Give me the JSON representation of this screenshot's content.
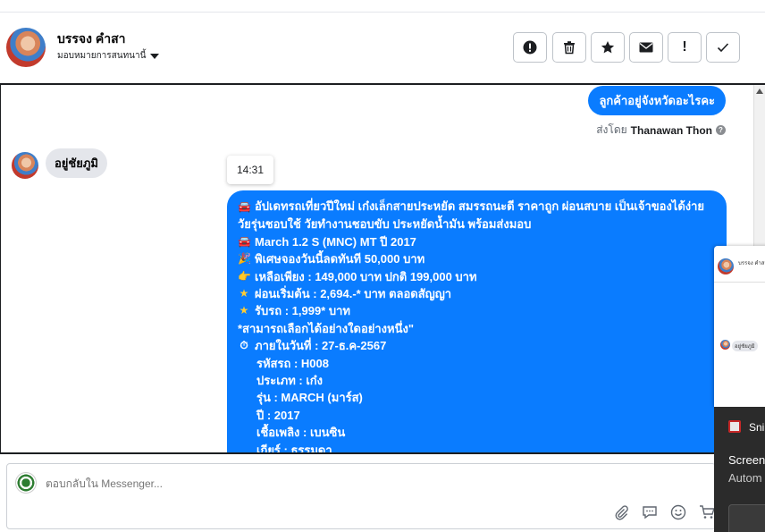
{
  "header": {
    "contact_name": "บรรจง คำสา",
    "assign_label": "มอบหมายการสนทนานี้",
    "actions": [
      {
        "icon": "alert-circle-icon"
      },
      {
        "icon": "trash-icon"
      },
      {
        "icon": "star-icon"
      },
      {
        "icon": "envelope-icon"
      },
      {
        "icon": "exclamation-icon",
        "glyph": "!"
      },
      {
        "icon": "checkmark-icon"
      }
    ]
  },
  "chat": {
    "outgoing_short": "ลูกค้าอยู่จังหวัดอะไรคะ",
    "sent_by_prefix": "ส่งโดย",
    "sent_by_name": "Thanawan Thon",
    "incoming": "อยู่ชัยภูมิ",
    "timestamp": "14:31",
    "accent_color": "#0a7cff",
    "long_message": {
      "l1": "อัปเดทรถเที่ยวปีใหม่ เก๋งเล็กสายประหยัด สมรรถนะดี ราคาถูก ผ่อนสบาย เป็นเจ้าของได้ง่าย วัยรุ่นชอบใช้ วัยทำงานชอบขับ ประหยัดน้ำมัน พร้อมส่งมอบ",
      "l2": "March 1.2 S (MNC) MT ปี 2017",
      "l3": "พิเศษจองวันนี้ลดทันที 50,000 บาท",
      "l4": "เหลือเพียง : 149,000 บาท ปกติ 199,000 บาท",
      "l5": "ผ่อนเริ่มต้น : 2,694.-* บาท ตลอดสัญญา",
      "l6": "รับรถ : 1,999* บาท",
      "l7": "*สามารถเลือกได้อย่างใดอย่างหนึ่ง\"",
      "l8": "ภายในวันที่ : 27-ธ.ค-2567",
      "l9": "รหัสรถ : H008",
      "l10": "ประเภท : เก๋ง",
      "l11": "รุ่น : MARCH (มาร์ส)",
      "l12": "ปี : 2017",
      "l13": "เชื้อเพลิง : เบนซิน",
      "l14": "เกียร์ : ธรรมดา"
    }
  },
  "composer": {
    "placeholder": "ตอบกลับใน Messenger..."
  },
  "overlay": {
    "mini_name": "บรรจง คำสา",
    "mini_message": "อยู่ชัยภูมิ",
    "snip_title": "Sni",
    "snip_heading": "Screen",
    "snip_body": "Autom"
  }
}
